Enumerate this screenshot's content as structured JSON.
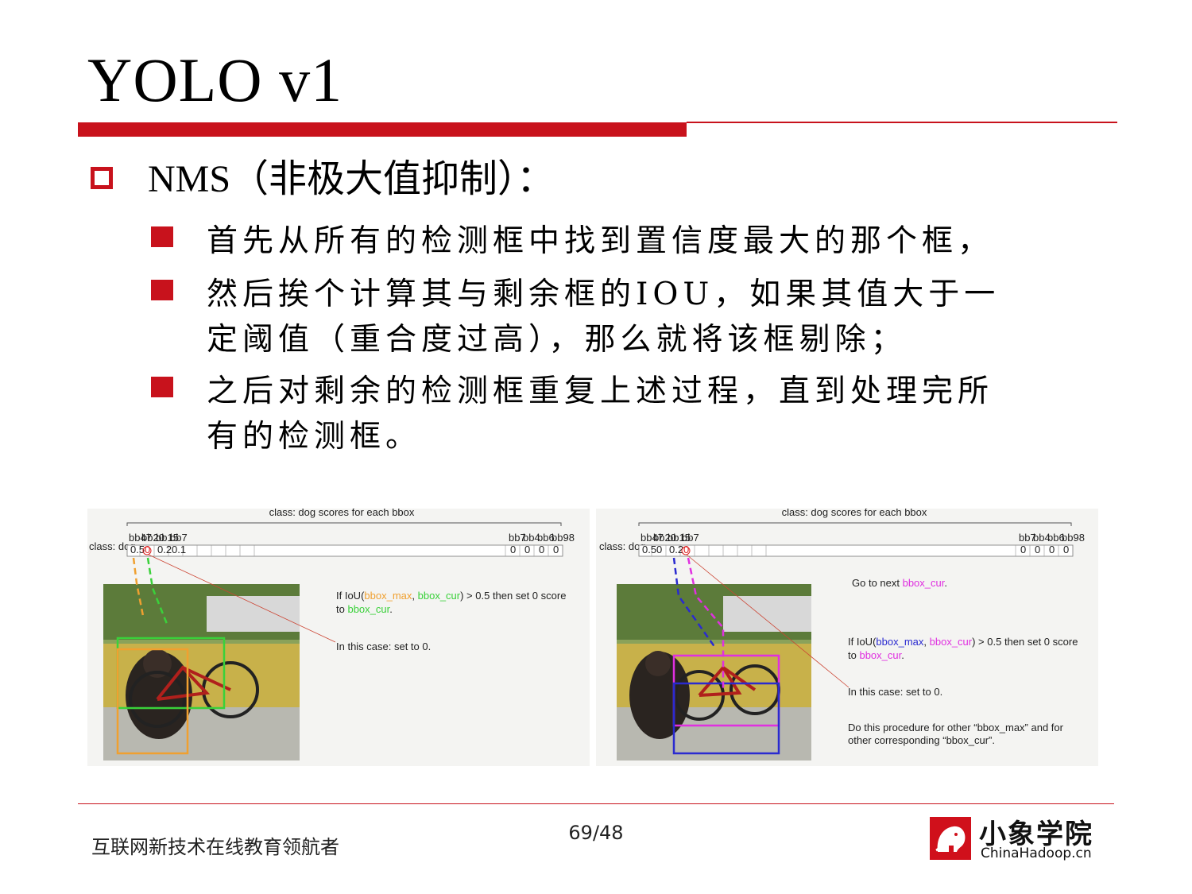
{
  "slide": {
    "title": "YOLO v1",
    "heading": "NMS（非极大值抑制）：",
    "bullets": [
      {
        "line1": "首先从所有的检测框中找到置信度最大的那个框，",
        "line2": ""
      },
      {
        "line1": "然后挨个计算其与剩余框的IOU，如果其值大于一",
        "line2": "定阈值（重合度过高），那么就将该框剔除；"
      },
      {
        "line1": "之后对剩余的检测框重复上述过程，直到处理完所",
        "line2": "有的检测框。"
      }
    ]
  },
  "figure_left": {
    "top_label": "class: dog scores for each bbox",
    "row_label": "class: dog",
    "box_labels": [
      "bb47",
      "bb20",
      "bb15",
      "bb7",
      "bb7",
      "bb4",
      "bb6",
      "bb98"
    ],
    "cell_values_left": [
      "0.5",
      "0",
      "0.2",
      "0.1"
    ],
    "cell_values_right": [
      "0",
      "0",
      "0",
      "0"
    ],
    "text1_pre": "If IoU(",
    "text1_a": "bbox_max",
    "text1_mid": ", ",
    "text1_b": "bbox_cur",
    "text1_post": ") > 0.5 then set 0 score",
    "text2_pre": "to ",
    "text2_b": "bbox_cur",
    "text2_post": ".",
    "text3": "In this case: set to 0.",
    "colors": {
      "max": "#f0a030",
      "cur": "#3ad13a"
    }
  },
  "figure_right": {
    "top_label": "class: dog scores for each bbox",
    "row_label": "class: dog",
    "box_labels": [
      "bb47",
      "bb20",
      "bb15",
      "bb7",
      "bb7",
      "bb4",
      "bb6",
      "bb98"
    ],
    "cell_values_left": [
      "0.5",
      "0",
      "0.2",
      "0"
    ],
    "cell_values_right": [
      "0",
      "0",
      "0",
      "0"
    ],
    "goto_pre": "Go to next ",
    "goto_b": "bbox_cur",
    "goto_post": ".",
    "text1_pre": "If IoU(",
    "text1_a": "bbox_max",
    "text1_mid": ", ",
    "text1_b": "bbox_cur",
    "text1_post": ") > 0.5 then set 0 score",
    "text2_pre": "to ",
    "text2_b": "bbox_cur",
    "text2_post": ".",
    "text3": "In this case: set to 0.",
    "text4": "Do this procedure for other “bbox_max” and for",
    "text5": "other corresponding “bbox_cur”.",
    "colors": {
      "max": "#2a2ad0",
      "cur": "#e030e0"
    }
  },
  "footer": {
    "tagline": "互联网新技术在线教育领航者",
    "page": "69/48",
    "logo_cn": "小象学院",
    "logo_en": "ChinaHadoop.cn"
  }
}
